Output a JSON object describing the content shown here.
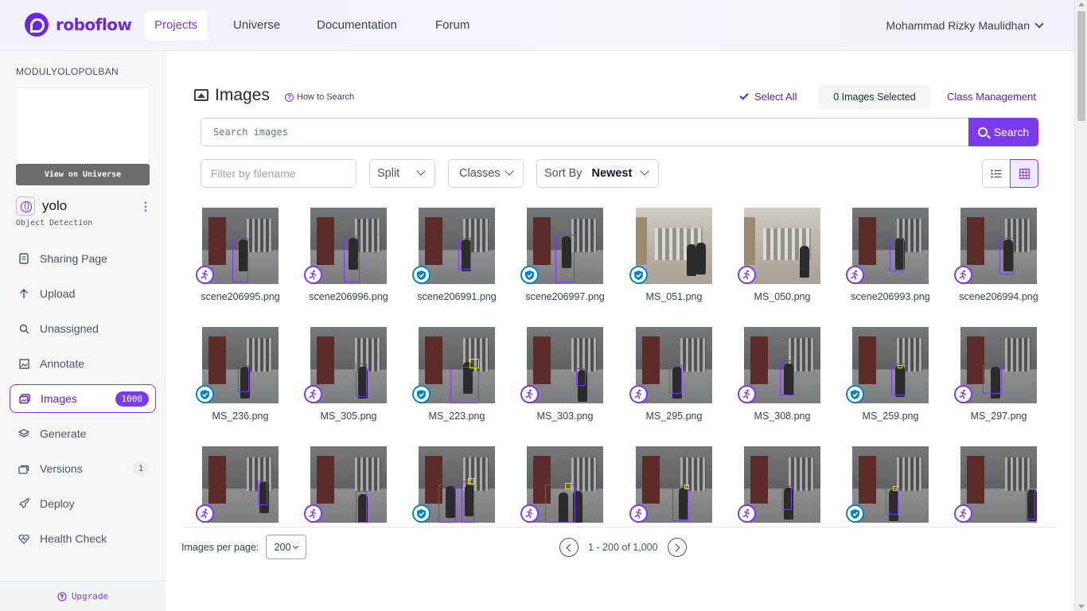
{
  "nav": {
    "logo_text": "roboflow",
    "items": [
      {
        "label": "Projects",
        "active": true
      },
      {
        "label": "Universe",
        "active": false
      },
      {
        "label": "Documentation",
        "active": false
      },
      {
        "label": "Forum",
        "active": false
      }
    ],
    "user_name": "Mohammad Rizky Maulidhan"
  },
  "sidebar": {
    "workspace": "MODULYOLOPOLBAN",
    "view_universe_label": "View on Universe",
    "project_name": "yolo",
    "project_type": "Object Detection",
    "items": [
      {
        "label": "Sharing Page",
        "icon": "document-icon"
      },
      {
        "label": "Upload",
        "icon": "upload-arrow-icon"
      },
      {
        "label": "Unassigned",
        "icon": "search-icon"
      },
      {
        "label": "Annotate",
        "icon": "annotate-image-icon"
      },
      {
        "label": "Images",
        "icon": "images-icon",
        "badge": "1000",
        "active": true
      },
      {
        "label": "Generate",
        "icon": "layers-icon"
      },
      {
        "label": "Versions",
        "icon": "versions-stack-icon",
        "badge": "1"
      },
      {
        "label": "Deploy",
        "icon": "rocket-icon"
      },
      {
        "label": "Health Check",
        "icon": "heart-pulse-icon"
      }
    ],
    "upgrade_label": "Upgrade"
  },
  "header": {
    "title": "Images",
    "how_to_search": "How to Search",
    "select_all": "Select All",
    "selected_count": "0 Images Selected",
    "class_management": "Class Management"
  },
  "search": {
    "placeholder": "Search images",
    "button_label": "Search"
  },
  "filters": {
    "filename_placeholder": "Filter by filename",
    "split_label": "Split",
    "classes_label": "Classes",
    "sort_by_label": "Sort By",
    "sort_value": "Newest"
  },
  "images": [
    {
      "name": "scene206995.png",
      "status": "annotating"
    },
    {
      "name": "scene206996.png",
      "status": "annotating"
    },
    {
      "name": "scene206991.png",
      "status": "approved"
    },
    {
      "name": "scene206997.png",
      "status": "approved"
    },
    {
      "name": "MS_051.png",
      "status": "approved"
    },
    {
      "name": "MS_050.png",
      "status": "annotating"
    },
    {
      "name": "scene206993.png",
      "status": "annotating"
    },
    {
      "name": "scene206994.png",
      "status": "annotating"
    },
    {
      "name": "MS_236.png",
      "status": "approved"
    },
    {
      "name": "MS_305.png",
      "status": "annotating"
    },
    {
      "name": "MS_223.png",
      "status": "approved"
    },
    {
      "name": "MS_303.png",
      "status": "annotating"
    },
    {
      "name": "MS_295.png",
      "status": "annotating"
    },
    {
      "name": "MS_308.png",
      "status": "annotating"
    },
    {
      "name": "MS_259.png",
      "status": "approved"
    },
    {
      "name": "MS_297.png",
      "status": "annotating"
    },
    {
      "name": "",
      "status": "annotating"
    },
    {
      "name": "",
      "status": "annotating"
    },
    {
      "name": "",
      "status": "approved"
    },
    {
      "name": "",
      "status": "annotating"
    },
    {
      "name": "",
      "status": "annotating"
    },
    {
      "name": "",
      "status": "annotating"
    },
    {
      "name": "",
      "status": "approved"
    },
    {
      "name": "",
      "status": "annotating"
    }
  ],
  "pagination": {
    "per_page_label": "Images per page:",
    "per_page_value": "200",
    "range": "1 - 200 of 1,000"
  },
  "colors": {
    "brand": "#7c3aed",
    "approved": "#0284c7"
  }
}
